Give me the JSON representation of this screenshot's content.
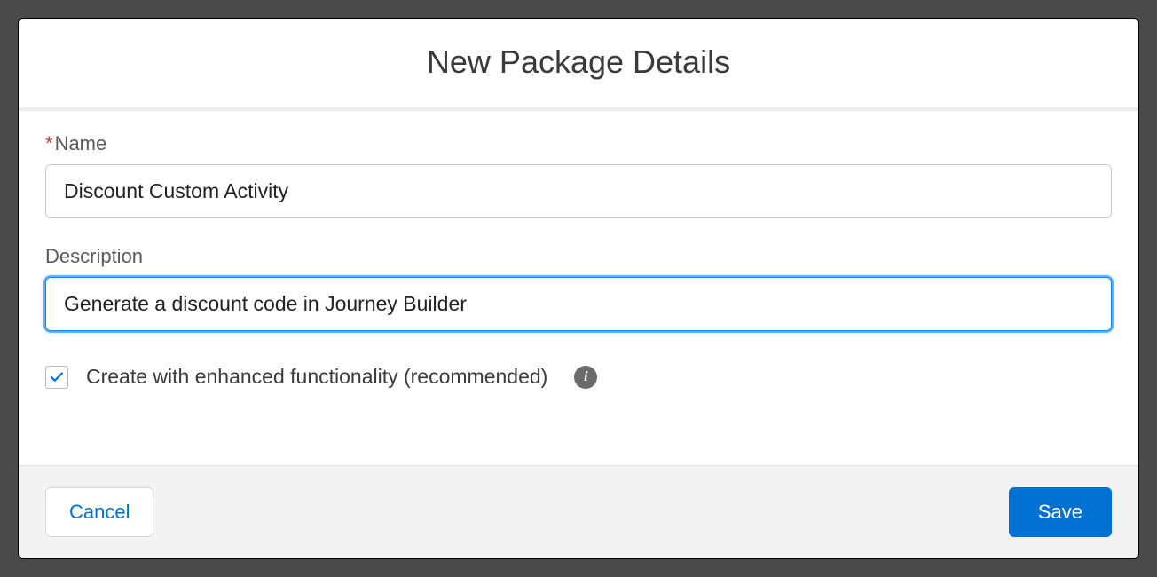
{
  "modal": {
    "title": "New Package Details"
  },
  "fields": {
    "name": {
      "label": "Name",
      "required_marker": "*",
      "value": "Discount Custom Activity"
    },
    "description": {
      "label": "Description",
      "value": "Generate a discount code in Journey Builder"
    },
    "enhanced": {
      "label": "Create with enhanced functionality (recommended)",
      "checked": true
    }
  },
  "footer": {
    "cancel_label": "Cancel",
    "save_label": "Save"
  }
}
